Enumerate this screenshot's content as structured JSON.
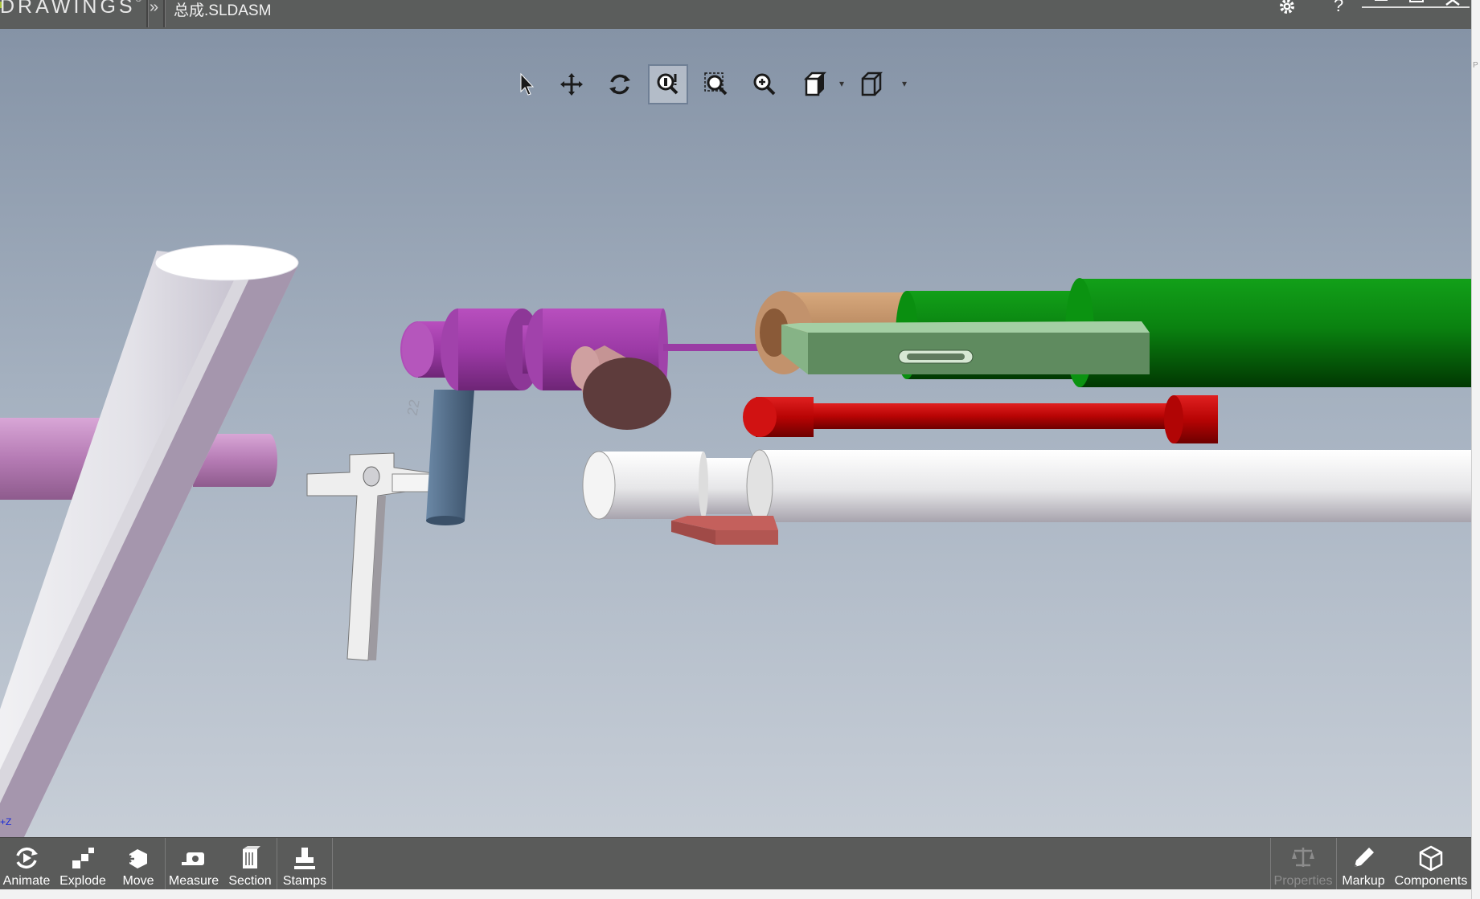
{
  "app": {
    "brand": "DRAWINGS",
    "brand_mark": "®"
  },
  "titlebar": {
    "chevron": "»",
    "document_title": "总成.SLDASM",
    "icons": [
      "gear-icon",
      "help-icon",
      "minimize-icon",
      "maximize-icon",
      "close-icon"
    ]
  },
  "heads_up_toolbar": {
    "tools": [
      {
        "name": "select",
        "icon": "pointer-arrow-icon"
      },
      {
        "name": "pan",
        "icon": "move-arrows-icon"
      },
      {
        "name": "rotate",
        "icon": "rotate-icon"
      },
      {
        "name": "zoom-to-fit",
        "icon": "zoom-fit-icon",
        "active": true
      },
      {
        "name": "zoom-to-area",
        "icon": "zoom-area-icon"
      },
      {
        "name": "zoom-in-out",
        "icon": "zoom-icon"
      },
      {
        "name": "view-orientation",
        "icon": "view-orientation-icon",
        "has_dropdown": true
      },
      {
        "name": "display-style",
        "icon": "display-style-cube-icon",
        "has_dropdown": true
      }
    ],
    "dropdown_glyph": "▾"
  },
  "viewport": {
    "background_top": "#8593a6",
    "background_bottom": "#c7ced7",
    "parts": [
      {
        "name": "frame-tube",
        "color": "#e0dfe6"
      },
      {
        "name": "crossbar-pin",
        "color": "#b97fb4"
      },
      {
        "name": "bracket-l",
        "color": "#dcdcdc"
      },
      {
        "name": "blue-pin",
        "color": "#4d6a85"
      },
      {
        "name": "purple-cylinder",
        "color": "#b24db8"
      },
      {
        "name": "rose-knob",
        "color": "#b58585"
      },
      {
        "name": "bronze-sleeve",
        "color": "#c2926c"
      },
      {
        "name": "green-tube",
        "color": "#0d8a12"
      },
      {
        "name": "green-slotted-bar",
        "color": "#7faf7f"
      },
      {
        "name": "red-rod",
        "color": "#cc0505"
      },
      {
        "name": "white-shaft",
        "color": "#e4e4e4"
      },
      {
        "name": "salmon-tab",
        "color": "#c2605b"
      }
    ],
    "axis_glyph": "+Z"
  },
  "bottom_toolbar": {
    "left": [
      {
        "label": "Animate",
        "icon": "animate-icon"
      },
      {
        "label": "Explode",
        "icon": "explode-icon"
      },
      {
        "label": "Move",
        "icon": "move-icon"
      },
      {
        "label": "Measure",
        "icon": "measure-icon"
      },
      {
        "label": "Section",
        "icon": "section-icon"
      },
      {
        "label": "Stamps",
        "icon": "stamps-icon"
      }
    ],
    "right": [
      {
        "label": "Properties",
        "icon": "properties-scale-icon",
        "disabled": true
      },
      {
        "label": "Markup",
        "icon": "markup-pencil-icon"
      },
      {
        "label": "Components",
        "icon": "components-icon"
      }
    ]
  }
}
